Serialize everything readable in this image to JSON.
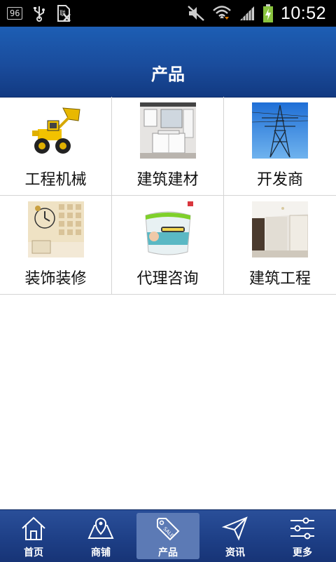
{
  "status_bar": {
    "badge": "96",
    "time": "10:52"
  },
  "header": {
    "title": "产品"
  },
  "categories": [
    {
      "label": "工程机械",
      "icon": "loader-image"
    },
    {
      "label": "建筑建材",
      "icon": "bathroom-cabinet-image"
    },
    {
      "label": "开发商",
      "icon": "power-tower-image"
    },
    {
      "label": "装饰装修",
      "icon": "wall-clock-decor-image"
    },
    {
      "label": "代理咨询",
      "icon": "paint-bucket-image"
    },
    {
      "label": "建筑工程",
      "icon": "interior-ceiling-image"
    }
  ],
  "nav": [
    {
      "label": "首页",
      "icon": "home-icon"
    },
    {
      "label": "商铺",
      "icon": "map-icon"
    },
    {
      "label": "产品",
      "icon": "sale-tag-icon",
      "active": true
    },
    {
      "label": "资讯",
      "icon": "paper-plane-icon"
    },
    {
      "label": "更多",
      "icon": "sliders-icon"
    }
  ]
}
